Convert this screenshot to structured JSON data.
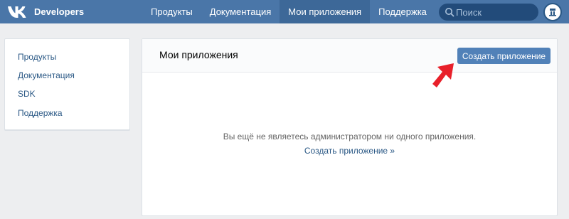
{
  "header": {
    "brand": "Developers",
    "logo_icon": "vk-logo-icon",
    "nav": [
      {
        "label": "Продукты",
        "active": false
      },
      {
        "label": "Документация",
        "active": false
      },
      {
        "label": "Мои приложения",
        "active": true
      },
      {
        "label": "Поддержка",
        "active": false
      }
    ],
    "search": {
      "placeholder": "Поиск",
      "icon": "search-icon"
    },
    "avatar_icon": "user-avatar-icon"
  },
  "sidebar": {
    "items": [
      {
        "label": "Продукты"
      },
      {
        "label": "Документация"
      },
      {
        "label": "SDK"
      },
      {
        "label": "Поддержка"
      }
    ]
  },
  "main": {
    "title": "Мои приложения",
    "create_button": "Создать приложение",
    "empty_text": "Вы ещё не являетесь администратором ни одного приложения.",
    "empty_link": "Создать приложение »"
  },
  "annotation": {
    "icon": "red-arrow-icon",
    "color": "#e8202a"
  },
  "colors": {
    "header": "#4a76a8",
    "button": "#5181b8",
    "link": "#2a5885"
  }
}
